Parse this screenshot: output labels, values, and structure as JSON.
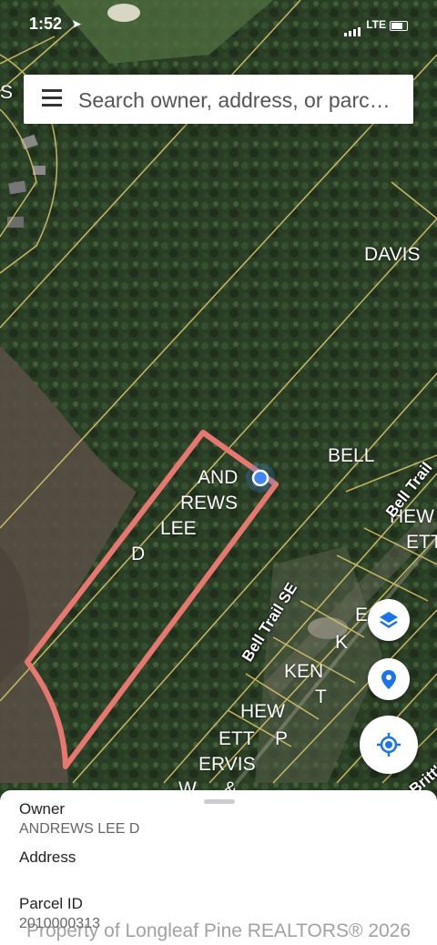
{
  "status_bar": {
    "time": "1:52",
    "network": "LTE"
  },
  "search": {
    "placeholder": "Search owner, address, or parc…"
  },
  "map_labels": {
    "s": "S",
    "davis": "DAVIS",
    "bell": "BELL",
    "andrews_line1": "AND",
    "andrews_line2": "REWS",
    "lee": "LEE",
    "d": "D",
    "hew_line1": "HEW",
    "hew_line2": "ETT",
    "e": "E",
    "k": "K",
    "kent_line1": "KEN",
    "kent_line2": "T",
    "hewett2_line1": "HEW",
    "hewett2_line2": "ETT",
    "p": "P",
    "ervis": "ERVIS",
    "w": "W",
    "amp": "&"
  },
  "road_labels": {
    "bell_trail_se": "Bell Trail SE",
    "bell_trail": "Bell Trail",
    "britts": "Britt's"
  },
  "colors": {
    "parcel_outline": "#e8776f",
    "parcel_lines": "#d8c46a",
    "location_dot": "#4285f4"
  },
  "icons": {
    "layers": "layers-icon",
    "location_pin": "location-pin-icon",
    "my_location": "my-location-icon",
    "menu": "menu-icon"
  },
  "details": {
    "owner_label": "Owner",
    "owner_value": "ANDREWS LEE D",
    "address_label": "Address",
    "parcel_label": "Parcel ID",
    "parcel_value": "2010000313"
  },
  "watermark": "Property of Longleaf Pine REALTORS® 2026"
}
